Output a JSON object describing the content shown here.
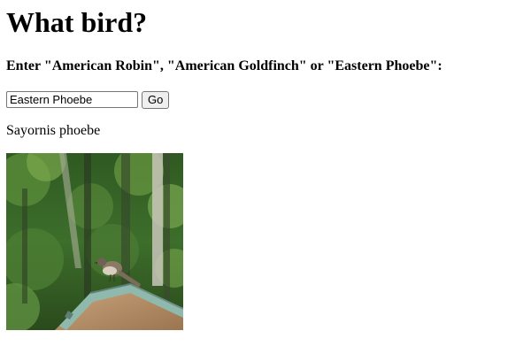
{
  "page": {
    "title": "What bird?",
    "instructions": "Enter \"American Robin\", \"American Goldfinch\" or \"Eastern Phoebe\":"
  },
  "form": {
    "input_value": "Eastern Phoebe",
    "submit_label": "Go"
  },
  "result": {
    "scientific_name": "Sayornis phoebe"
  },
  "image": {
    "alt": "Sayornis phoebe"
  }
}
